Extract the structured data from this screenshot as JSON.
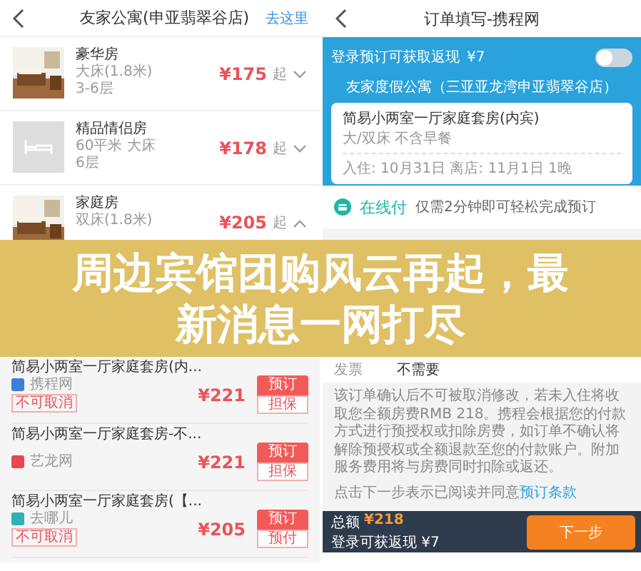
{
  "hotel_screen": {
    "title": "友家公寓(申亚翡翠谷店)",
    "action": "去这里",
    "rooms": [
      {
        "name": "豪华房",
        "details": [
          "大床(1.8米)",
          "3-6层"
        ],
        "price": "¥175",
        "suffix": "起",
        "expanded": false
      },
      {
        "name": "精品情侣房",
        "details": [
          "60平米 大床",
          "6层"
        ],
        "price": "¥178",
        "suffix": "起",
        "expanded": false,
        "kind": "placeholder"
      },
      {
        "name": "家庭房",
        "details": [
          "双床(1.8米)"
        ],
        "price": "¥205",
        "suffix": "起",
        "expanded": true
      }
    ],
    "offers": [
      {
        "name": "简易小两室一厅家庭套房(内...",
        "source": "携程网",
        "color": "#3b7fd9",
        "tags": [
          "不可取消"
        ],
        "price": "¥221",
        "book": "预订",
        "note": "担保"
      },
      {
        "name": "简易小两室一厅家庭套房-不...",
        "source": "艺龙网",
        "color": "#e8474f",
        "price": "¥221",
        "book": "预订",
        "note": "担保"
      },
      {
        "name": "简易小两室一厅家庭套房(【...",
        "source": "去哪儿",
        "color": "#2bb3b8",
        "tags": [
          "不可取消"
        ],
        "price": "¥205",
        "book": "预订",
        "note": "预付"
      }
    ]
  },
  "order_screen": {
    "title": "订单填写-携程网",
    "cashback": {
      "label": "登录预订可获取返现",
      "amount": "¥7",
      "on": false
    },
    "hotel": "友家度假公寓（三亚亚龙湾申亚翡翠谷店）",
    "room": {
      "name": "简易小两室一厅家庭套房(内宾)",
      "details": "大/双床 不含早餐",
      "stay": "入住: 10月31日  离店: 11月1日 1晚"
    },
    "payment": {
      "label": "在线付",
      "hint": "仅需2分钟即可轻松完成预订"
    },
    "invoice": {
      "label": "发票",
      "value": "不需要"
    },
    "notice": "该订单确认后不可被取消修改，若未入住将收取您全额房费RMB 218。携程会根据您的付款方式进行预授权或扣除房费，如订单不确认将解除预授权或全额退款至您的付款账户。附加服务费用将与房费同时扣除或返还。",
    "agreement": {
      "text": "点击下一步表示已阅读并同意",
      "link": "预订条款"
    },
    "footer": {
      "total_label": "总额",
      "total": "¥218",
      "cashback": "登录可获返现 ¥7",
      "next": "下一步"
    }
  },
  "banner": {
    "headline": "周边宾馆团购风云再起，最新消息一网打尽"
  }
}
